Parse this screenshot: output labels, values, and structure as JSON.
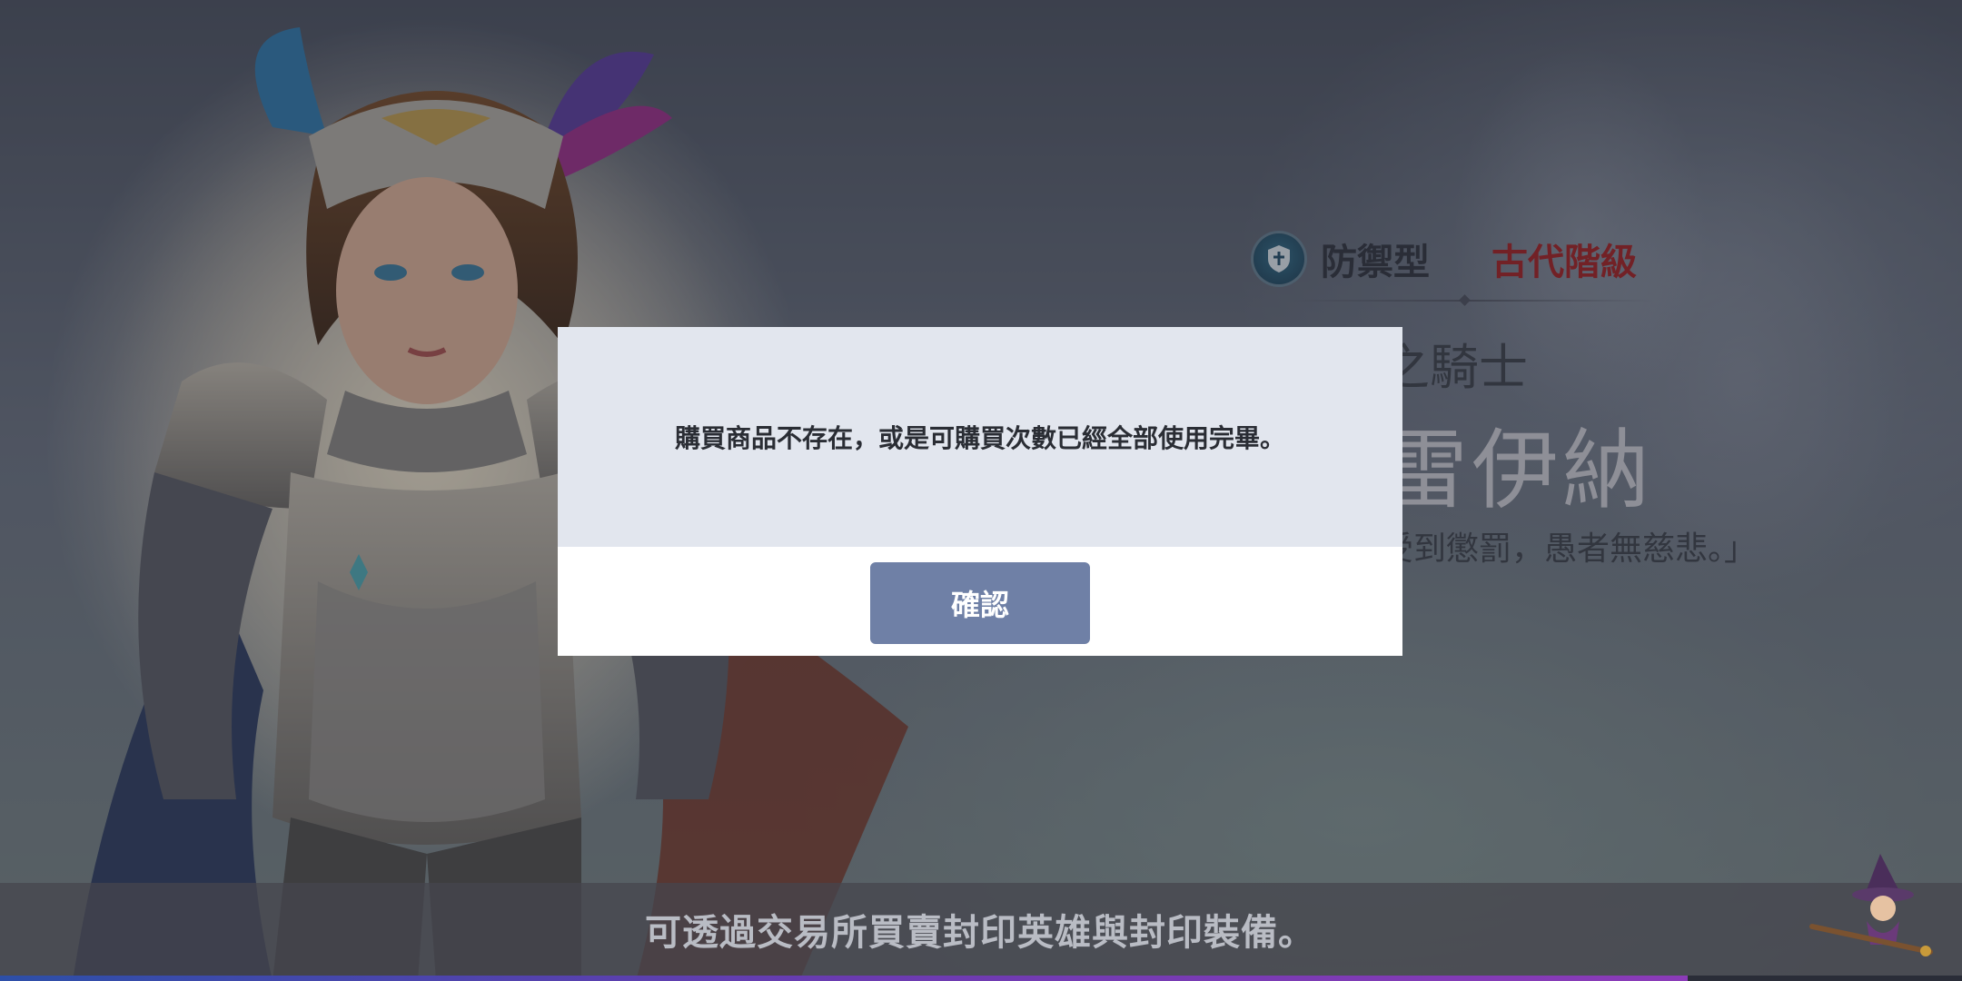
{
  "hero_info": {
    "type_label": "防禦型",
    "grade_label": "古代階級",
    "title_visible": "之騎士",
    "name_visible": "雷伊納",
    "quote_visible": "受到懲罰，愚者無慈悲。」"
  },
  "dialog": {
    "message": "購買商品不存在，或是可購買次數已經全部使用完畢。",
    "confirm_label": "確認"
  },
  "tip": {
    "text": "可透過交易所買賣封印英雄與封印裝備。"
  },
  "loading": {
    "progress_fraction": 0.86
  },
  "colors": {
    "grade": "#a81b1b",
    "confirm_button": "#6f80a6",
    "dialog_msg_bg": "#e2e6ee"
  },
  "icons": {
    "type_icon": "shield-icon",
    "mascot": "witch-mascot-icon"
  }
}
